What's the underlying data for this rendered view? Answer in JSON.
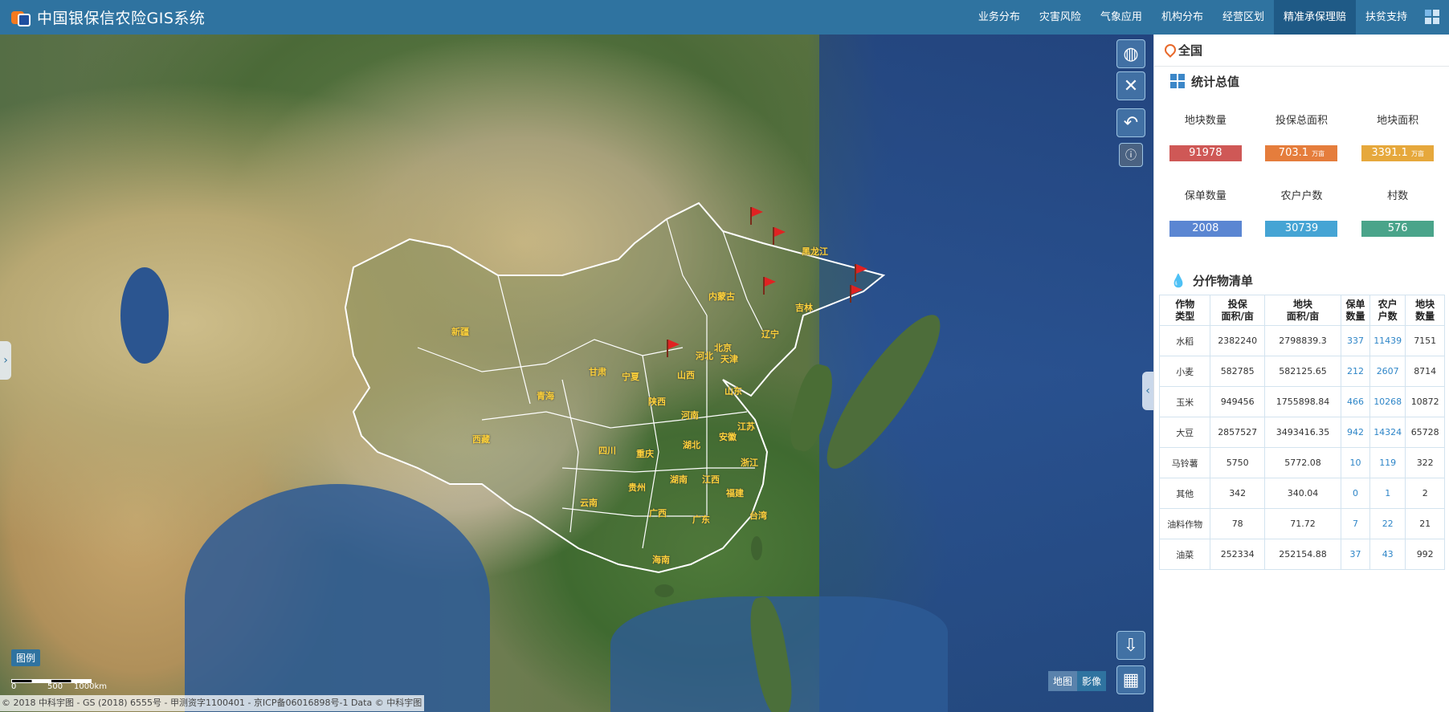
{
  "header": {
    "title": "中国银保信农险GIS系统",
    "nav": [
      {
        "label": "业务分布",
        "active": false
      },
      {
        "label": "灾害风险",
        "active": false
      },
      {
        "label": "气象应用",
        "active": false
      },
      {
        "label": "机构分布",
        "active": false
      },
      {
        "label": "经营区划",
        "active": false
      },
      {
        "label": "精准承保理赔",
        "active": true
      },
      {
        "label": "扶贫支持",
        "active": false
      }
    ]
  },
  "map": {
    "provinces": [
      "黑龙江",
      "吉林",
      "辽宁",
      "内蒙古",
      "新疆",
      "西藏",
      "青海",
      "甘肃",
      "宁夏",
      "陕西",
      "山西",
      "北京",
      "天津",
      "河北",
      "山东",
      "河南",
      "江苏",
      "安徽",
      "湖北",
      "四川",
      "重庆",
      "浙江",
      "江西",
      "湖南",
      "贵州",
      "福建",
      "云南",
      "广西",
      "广东",
      "台湾",
      "海南"
    ],
    "legend_label": "图例",
    "scale_labels": [
      "0",
      "500",
      "1000km"
    ],
    "basemap_options": [
      {
        "label": "地图",
        "active": false
      },
      {
        "label": "影像",
        "active": true
      }
    ],
    "attribution": "© 2018 中科宇图 - GS (2018) 6555号 - 甲测资字1100401 - 京ICP备06016898号-1 Data © 中科宇图"
  },
  "panel": {
    "location": "全国",
    "stats_title": "统计总值",
    "stats": [
      {
        "label": "地块数量",
        "value": "91978",
        "unit": "",
        "color": "#cf5856"
      },
      {
        "label": "投保总面积",
        "value": "703.1",
        "unit": "万亩",
        "color": "#e57d3c"
      },
      {
        "label": "地块面积",
        "value": "3391.1",
        "unit": "万亩",
        "color": "#e6a83c"
      },
      {
        "label": "保单数量",
        "value": "2008",
        "unit": "",
        "color": "#5b86d2"
      },
      {
        "label": "农户户数",
        "value": "30739",
        "unit": "",
        "color": "#45a4d4"
      },
      {
        "label": "村数",
        "value": "576",
        "unit": "",
        "color": "#4aa48a"
      }
    ],
    "crops_title": "分作物清单",
    "crop_table": {
      "headers": [
        "作物\n类型",
        "投保\n面积/亩",
        "地块\n面积/亩",
        "保单\n数量",
        "农户\n户数",
        "地块\n数量"
      ],
      "rows": [
        [
          "水稻",
          "2382240",
          "2798839.3",
          "337",
          "11439",
          "7151"
        ],
        [
          "小麦",
          "582785",
          "582125.65",
          "212",
          "2607",
          "8714"
        ],
        [
          "玉米",
          "949456",
          "1755898.84",
          "466",
          "10268",
          "10872"
        ],
        [
          "大豆",
          "2857527",
          "3493416.35",
          "942",
          "14324",
          "65728"
        ],
        [
          "马铃薯",
          "5750",
          "5772.08",
          "10",
          "119",
          "322"
        ],
        [
          "其他",
          "342",
          "340.04",
          "0",
          "1",
          "2"
        ],
        [
          "油料作物",
          "78",
          "71.72",
          "7",
          "22",
          "21"
        ],
        [
          "油菜",
          "252334",
          "252154.88",
          "37",
          "43",
          "992"
        ]
      ]
    }
  }
}
